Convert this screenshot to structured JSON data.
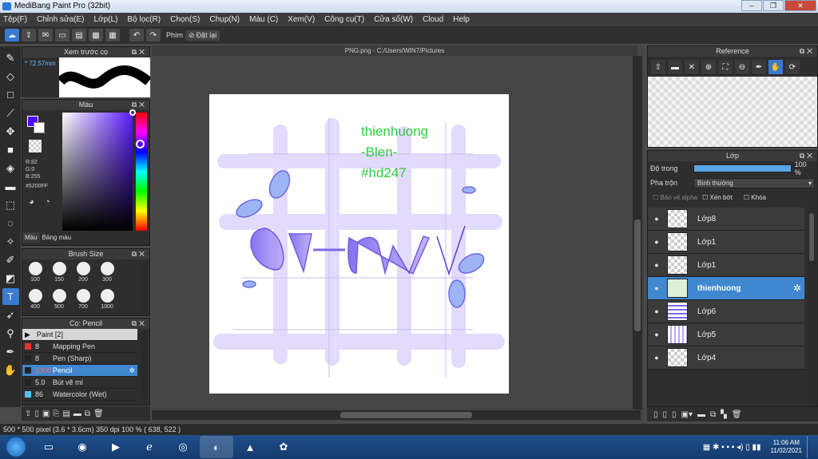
{
  "title": "MediBang Paint Pro (32bit)",
  "menu": [
    "Tệp(F)",
    "Chỉnh sửa(E)",
    "Lớp(L)",
    "Bộ lọc(R)",
    "Chọn(S)",
    "Chụp(N)",
    "Màu (C)",
    "Xem(V)",
    "Công cụ(T)",
    "Cửa sổ(W)",
    "Cloud",
    "Help"
  ],
  "toolbar": {
    "hotkey_label": "Phím",
    "reset_label": "Đặt lại"
  },
  "preview": {
    "title": "Xem trước cọ",
    "size": "72.57mm"
  },
  "color": {
    "title": "Màu",
    "r": "R:82",
    "g": "G:0",
    "b": "B:255",
    "hex": "#5200FF",
    "tab1": "Màu",
    "tab2": "Bảng màu",
    "fg": "#5200ff",
    "bg": "#ffffff"
  },
  "brushsize": {
    "title": "Brush Size",
    "sizes": [
      "100",
      "150",
      "200",
      "300",
      "400",
      "500",
      "700",
      "1000"
    ]
  },
  "brushes": {
    "title": "Cọ: Pencil",
    "group": "Paint [2]",
    "items": [
      {
        "size": "8",
        "name": "Mapping Pen",
        "color": "#e33"
      },
      {
        "size": "8",
        "name": "Pen (Sharp)",
        "color": "#222"
      },
      {
        "size": "1000",
        "name": "Pencil",
        "color": "#222"
      },
      {
        "size": "5.0",
        "name": "Bút vẽ mí",
        "color": "#222"
      },
      {
        "size": "86",
        "name": "Watercolor (Wet)",
        "color": "#4fc3f7"
      }
    ]
  },
  "document": {
    "tab": "PNG.png - C:/Users/WIN7/Pictures",
    "text1": "thienhuong",
    "text2": "-Blen-",
    "text3": "#hd247"
  },
  "reference": {
    "title": "Reference"
  },
  "layers": {
    "title": "Lớp",
    "opacity_label": "Độ trong",
    "opacity_value": "100 %",
    "opacity": 1.0,
    "blend_label": "Pha trộn",
    "blend_value": "Bình thường",
    "protect_alpha": "Bảo vệ alpha",
    "clipping": "Xén bớt",
    "lock": "Khóa",
    "items": [
      "Lớp8",
      "Lớp1",
      "Lớp1",
      "thienhuong",
      "Lớp6",
      "Lớp5",
      "Lớp4"
    ]
  },
  "status": "500 * 500 pixel  (3.6 * 3.6cm)  350 dpi  100 %  ( 638, 522 )",
  "clock": {
    "time": "11:06 AM",
    "date": "11/02/2021"
  }
}
